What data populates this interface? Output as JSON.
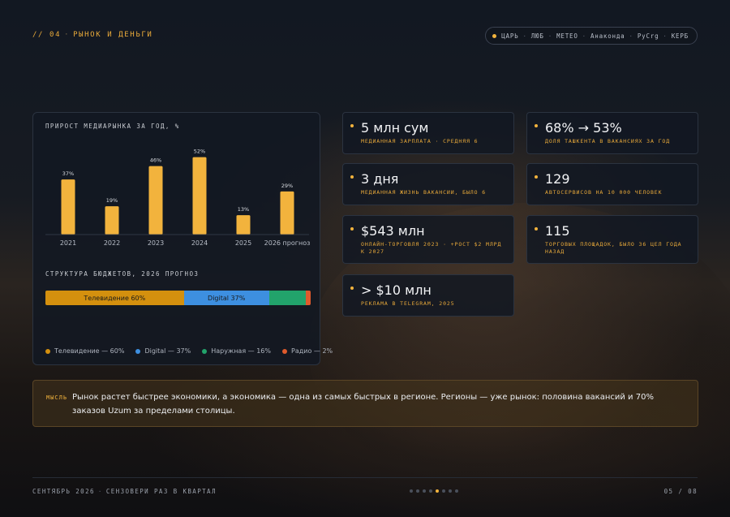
{
  "header": {
    "section_num": "// 04",
    "section_title": "РЫНОК И ДЕНЬГИ",
    "nav": [
      "ЦАРЬ",
      "ЛЮБ",
      "МЕТЕО",
      "Анаконда",
      "РуСrg",
      "КЕРБ"
    ]
  },
  "colors": {
    "accent": "#f2b33d",
    "tv": "#d4900e",
    "digital": "#3d8fe0",
    "outdoor": "#22a36b",
    "radio": "#e05a2c"
  },
  "chart_data": [
    {
      "type": "bar",
      "title": "ПРИРОСТ МЕДИАРЫНКА ЗА ГОД, %",
      "categories": [
        "2021",
        "2022",
        "2023",
        "2024",
        "2025",
        "2026 прогноз"
      ],
      "values": [
        37,
        19,
        46,
        52,
        13,
        29
      ],
      "value_labels": [
        "37%",
        "19%",
        "46%",
        "52%",
        "13%",
        "29%"
      ],
      "ylim": [
        0,
        60
      ],
      "grid": false
    },
    {
      "type": "bar",
      "title": "СТРУКТУРА БЮДЖЕТОВ, 2026 ПРОГНОЗ",
      "stacked": true,
      "segments": [
        {
          "name": "Телевидение",
          "value": 60,
          "bar_label": "Телевидение 60%",
          "legend": "Телевидение — 60%"
        },
        {
          "name": "Digital",
          "value": 37,
          "bar_label": "Digital 37%",
          "legend": "Digital — 37%"
        },
        {
          "name": "Наружная",
          "value": 16,
          "bar_label": "",
          "legend": "Наружная — 16%"
        },
        {
          "name": "Радио",
          "value": 2,
          "bar_label": "",
          "legend": "Радио — 2%"
        }
      ]
    }
  ],
  "cards": [
    {
      "value": "5 млн сум",
      "label": "МЕДИАННАЯ ЗАРПЛАТА · СРЕДНЯЯ 6"
    },
    {
      "value": "68% → 53%",
      "label": "ДОЛЯ ТАШКЕНТА В ВАКАНСИЯХ ЗА ГОД"
    },
    {
      "value": "3 дня",
      "label": "МЕДИАННАЯ ЖИЗНЬ ВАКАНСИИ, БЫЛО 6"
    },
    {
      "value": "129",
      "label": "АВТОСЕРВИСОВ НА 10 000 ЧЕЛОВЕК"
    },
    {
      "value": "$543 млн",
      "label": "ОНЛАЙН-ТОРГОВЛЯ 2023 · +РОСТ $2 МЛРД К 2027"
    },
    {
      "value": "115",
      "label": "ТОРГОВЫХ ПЛОЩАДОК, БЫЛО 36 ЦЕЛ ГОДА НАЗАД"
    },
    {
      "value": "> $10 млн",
      "label": "РЕКЛАМА В TELEGRAM, 2025"
    }
  ],
  "insight": {
    "tag": "МЫСЛЬ",
    "text": "Рынок растет быстрее экономики, а экономика — одна из самых быстрых в регионе. Регионы — уже рынок: половина вакансий и 70% заказов Uzum за пределами столицы."
  },
  "footer": {
    "date": "СЕНТЯБРЬ 2026",
    "tagline": "СЕНЗОВЕРИ РАЗ В КВАРТАЛ",
    "page": "05 / 08",
    "dots_total": 8,
    "dots_active": 5
  }
}
